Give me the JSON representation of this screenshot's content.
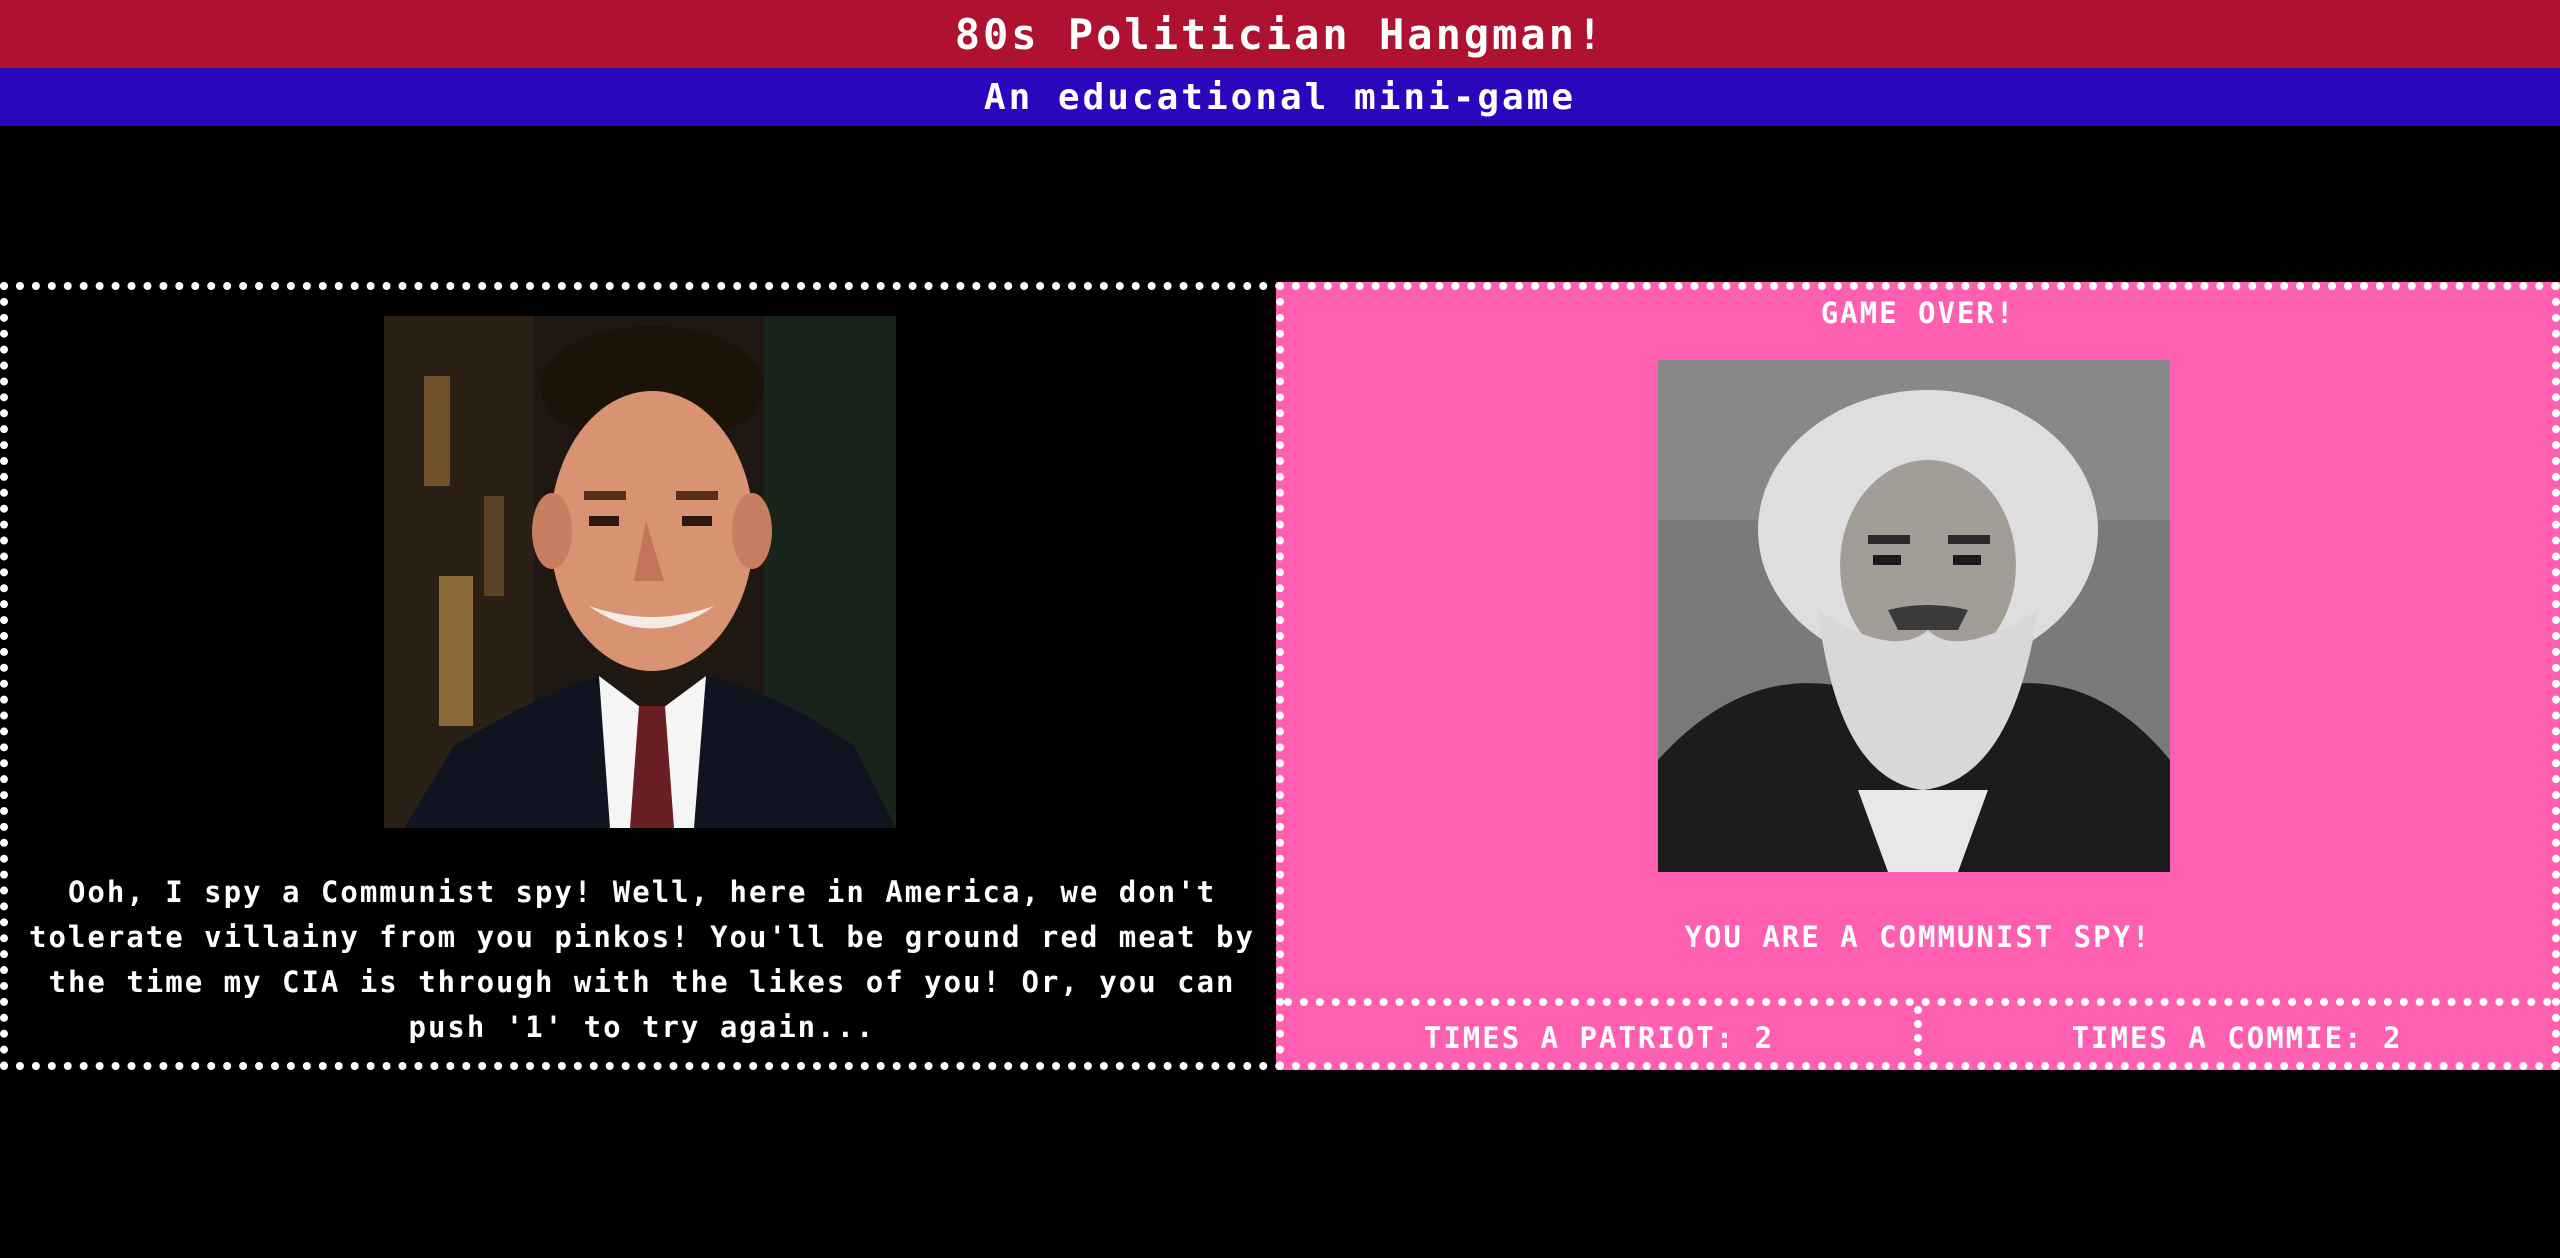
{
  "header": {
    "title": "80s Politician Hangman!",
    "subtitle": "An educational mini-game"
  },
  "left_panel": {
    "portrait_icon": "ronald-reagan-portrait",
    "taunt": "Ooh, I spy a Communist spy! Well, here in America, we don't tolerate villainy from you pinkos! You'll be ground red meat by the time my CIA is through with the likes of you! Or, you can push '1' to try again..."
  },
  "right_panel": {
    "status": "GAME OVER!",
    "portrait_icon": "karl-marx-portrait",
    "result": "YOU ARE A COMMUNIST SPY!",
    "scores": {
      "patriot_label": "TIMES A PATRIOT: 2",
      "commie_label": "TIMES A COMMIE: 2"
    }
  },
  "colors": {
    "title_bar": "#ae1230",
    "subtitle_bar": "#2a07bd",
    "right_panel_bg": "#ff5fb1",
    "background": "#000000"
  }
}
